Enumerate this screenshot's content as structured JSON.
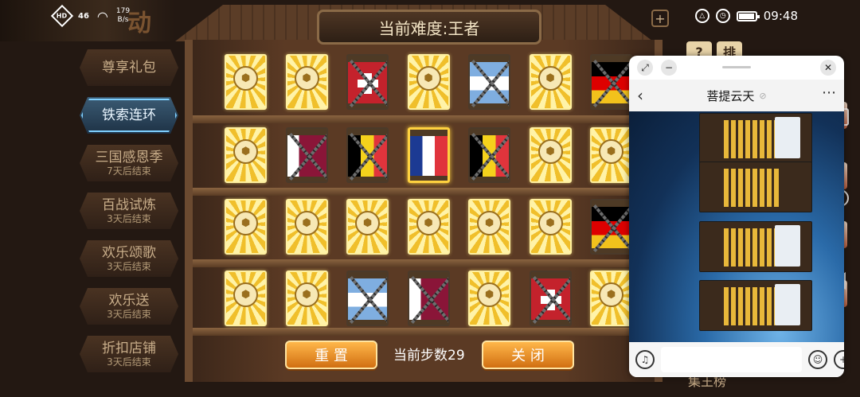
{
  "status_bar": {
    "hd": "HD",
    "signal": "46",
    "speed_value": "179",
    "speed_unit": "B/s",
    "time": "09:48"
  },
  "logo_char": "动",
  "menu": [
    {
      "label": "尊享礼包",
      "sub": "",
      "active": false
    },
    {
      "label": "铁索连环",
      "sub": "",
      "active": true
    },
    {
      "label": "三国感恩季",
      "sub": "7天后结束",
      "active": false
    },
    {
      "label": "百战试炼",
      "sub": "3天后结束",
      "active": false
    },
    {
      "label": "欢乐颂歌",
      "sub": "3天后结束",
      "active": false
    },
    {
      "label": "欢乐送",
      "sub": "3天后结束",
      "active": false
    },
    {
      "label": "折扣店铺",
      "sub": "3天后结束",
      "active": false
    }
  ],
  "game": {
    "title": "当前难度:王者",
    "steps_label": "当前步数29",
    "reset_button": "重 置",
    "close_button": "关 闭",
    "right_tabs": [
      "?",
      "排"
    ],
    "bottom_right": "集王榜",
    "grid": [
      [
        "ball",
        "ball",
        "switzerland",
        "ball",
        "argentina",
        "ball",
        "germany"
      ],
      [
        "ball",
        "qatar",
        "belgium",
        "france*",
        "belgium",
        "ball",
        "ball"
      ],
      [
        "ball",
        "ball",
        "ball",
        "ball",
        "ball",
        "ball",
        "germany"
      ],
      [
        "ball",
        "ball",
        "argentina",
        "qatar",
        "ball",
        "switzerland",
        "ball"
      ]
    ]
  },
  "chat": {
    "title": "菩提云天",
    "back_icon": "back-icon",
    "more_icon": "more-icon"
  }
}
